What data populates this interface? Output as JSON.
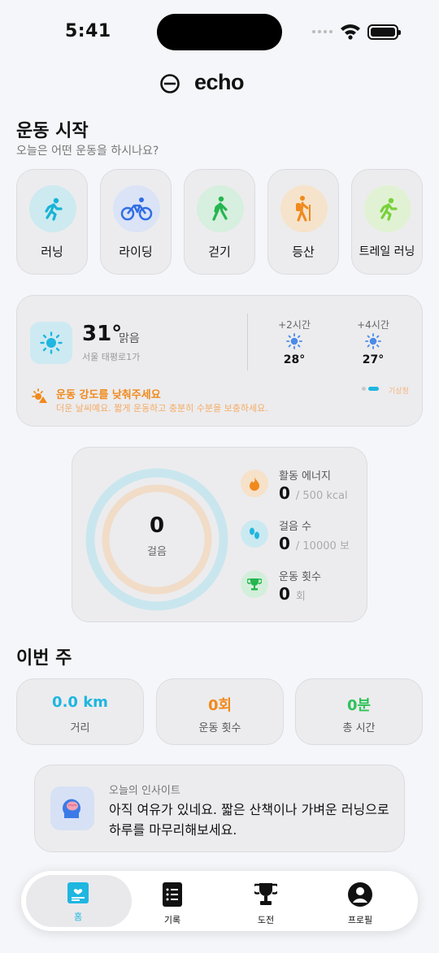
{
  "status_bar": {
    "time": "5:41"
  },
  "header": {
    "app_name": "echo"
  },
  "start": {
    "title": "운동 시작",
    "subtitle": "오늘은 어떤 운동을 하시나요?",
    "sports": [
      {
        "label": "러닝",
        "icon": "running-icon",
        "bg": "#cdeaf0",
        "color": "#17b4d6"
      },
      {
        "label": "라이딩",
        "icon": "cycling-icon",
        "bg": "#dbe3f7",
        "color": "#2f6ee6"
      },
      {
        "label": "걷기",
        "icon": "walking-icon",
        "bg": "#d6efde",
        "color": "#25b64f"
      },
      {
        "label": "등산",
        "icon": "hiking-icon",
        "bg": "#f6e3cb",
        "color": "#f08a1c"
      },
      {
        "label": "트레일 러닝",
        "icon": "trail-running-icon",
        "bg": "#e1f2d4",
        "color": "#78d13a"
      }
    ]
  },
  "weather": {
    "temp": "31°",
    "condition": "맑음",
    "location": "서울 태평로1가",
    "forecast": [
      {
        "label": "+2시간",
        "temp": "28°"
      },
      {
        "label": "+4시간",
        "temp": "27°"
      }
    ],
    "warning_title": "운동 강도를 낮춰주세요",
    "warning_text": "더운 날씨예요. 짧게 운동하고 충분히 수분을 보충하세요.",
    "source": "기상청"
  },
  "activity": {
    "steps_value": "0",
    "steps_label": "걸음",
    "progress": 0,
    "stats": [
      {
        "label": "활동 에너지",
        "value": "0",
        "unit": "/ 500 kcal",
        "icon": "flame-icon"
      },
      {
        "label": "걸음 수",
        "value": "0",
        "unit": "/ 10000 보",
        "icon": "footprints-icon"
      },
      {
        "label": "운동 횟수",
        "value": "0",
        "unit": "회",
        "icon": "trophy-icon"
      }
    ]
  },
  "week": {
    "title": "이번 주",
    "cards": [
      {
        "value": "0.0 km",
        "label": "거리",
        "color": "#1fb6e0"
      },
      {
        "value": "0회",
        "label": "운동 횟수",
        "color": "#f08a1c"
      },
      {
        "value": "0분",
        "label": "총 시간",
        "color": "#2fc25b"
      }
    ]
  },
  "insight": {
    "title": "오늘의 인사이트",
    "text": "아직 여유가 있네요. 짧은 산책이나 가벼운 러닝으로 하루를 마무리해보세요."
  },
  "bottom_nav": [
    {
      "label": "홈",
      "icon": "home-icon"
    },
    {
      "label": "기록",
      "icon": "records-icon"
    },
    {
      "label": "도전",
      "icon": "challenge-trophy-icon"
    },
    {
      "label": "프로필",
      "icon": "profile-icon"
    }
  ],
  "colors": {
    "accent": "#1fb6e0",
    "warning": "#f08a1c",
    "background": "#f5f6f9"
  }
}
